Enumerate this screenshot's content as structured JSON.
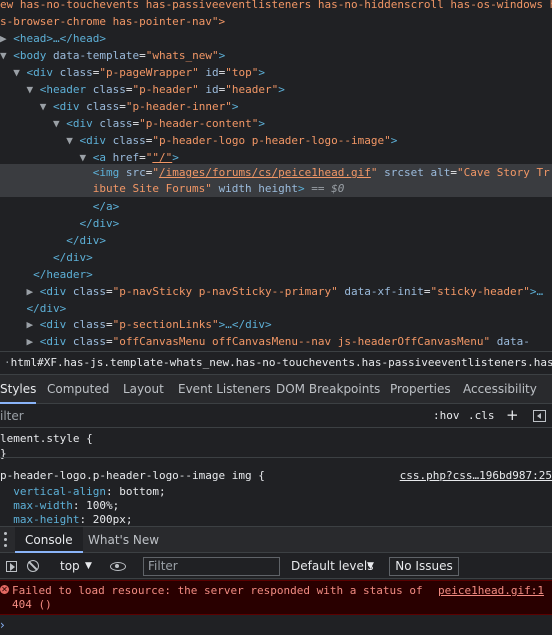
{
  "elements_tree": {
    "l0": "ew has-no-touchevents has-passiveeventlisteners has-no-hiddenscroll has-os-windows h",
    "l1": "s-browser-chrome has-pointer-nav\">",
    "head_collapsed": "<head>…</head>",
    "body_tag": "body",
    "body_attr": "data-template",
    "body_val": "\"whats_new\"",
    "page_wrapper_class": "\"p-pageWrapper\"",
    "page_wrapper_id": "\"top\"",
    "header_class": "\"p-header\"",
    "header_id": "\"header\"",
    "header_inner_class": "\"p-header-inner\"",
    "header_content_class": "\"p-header-content\"",
    "header_logo_class": "\"p-header-logo p-header-logo--image\"",
    "a_href": "\"/\"",
    "img_src": "/images/forums/cs/peice1head.gif",
    "img_alt_start": "\"Cave Story Tr",
    "img_alt_end": "ibute Site Forums\"",
    "img_rest": "width height",
    "eq0": "== ",
    "eq0_var": "$0",
    "navsticky_class": "\"p-navSticky p-navSticky--primary\"",
    "navsticky_attr": "data-xf-init",
    "navsticky_val": "\"sticky-header\"",
    "sectionlinks_class": "\"p-sectionLinks\"",
    "offcanvas_class": "\"offCanvasMenu offCanvasMenu--nav js-headerOffCanvasMenu\"",
    "offcanvas_tail": "data-"
  },
  "breadcrumb": {
    "text": "html#XF.has-js.template-whats_new.has-no-touchevents.has-passiveeventlisteners.has-no-hiddens",
    "dots": "·"
  },
  "styles_tabs": [
    "Styles",
    "Computed",
    "Layout",
    "Event Listeners",
    "DOM Breakpoints",
    "Properties",
    "Accessibility"
  ],
  "styles_filter": {
    "placeholder": "ilter",
    "hov": ":hov",
    "cls": ".cls",
    "plus": "+"
  },
  "rules": {
    "element_style": "lement.style {",
    "element_close": "}",
    "selector": "p-header-logo.p-header-logo--image img {",
    "source": "css.php?css…196bd987:25",
    "decls": [
      {
        "prop": "vertical-align",
        "val": "bottom"
      },
      {
        "prop": "max-width",
        "val": "100%"
      },
      {
        "prop": "max-height",
        "val": "200px"
      }
    ]
  },
  "drawer": {
    "tabs": [
      "Console",
      "What's New"
    ],
    "context": "top",
    "filter_placeholder": "Filter",
    "levels": "Default levels",
    "issues": "No Issues"
  },
  "error": {
    "line1": "Failed to load resource: the server responded with a status of",
    "line2": "404 ()",
    "link": "peice1head.gif:1"
  },
  "prompt": "›",
  "colors": {
    "background": "#202124",
    "tag": "#5db0d7",
    "attr_value": "#f29766",
    "error_text": "#f28b82",
    "error_bg": "#290000",
    "accent": "#8ab4f8"
  }
}
